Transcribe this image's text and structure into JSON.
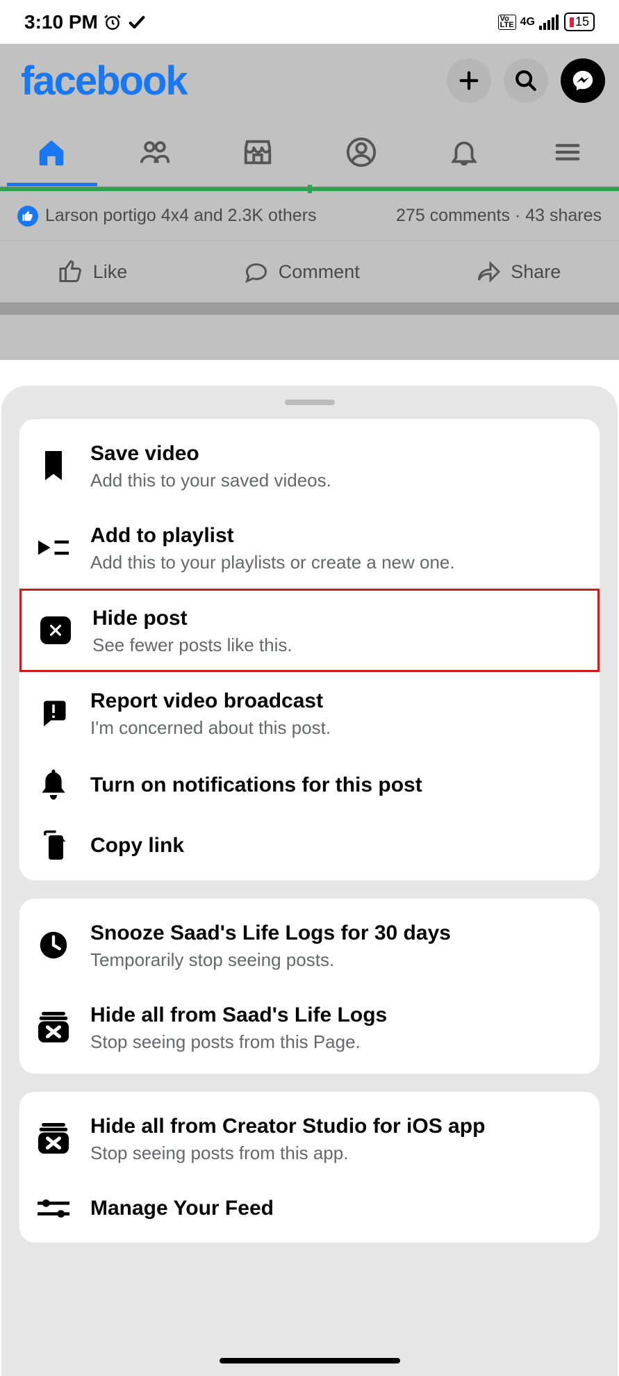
{
  "status": {
    "time": "3:10 PM",
    "network_label": "4G",
    "volte_label": "Vo\nLTE",
    "battery_pct": "15"
  },
  "fb": {
    "logo": "facebook"
  },
  "stats": {
    "likes_text": "Larson portigo 4x4 and 2.3K others",
    "comments_shares": "275 comments  ·  43 shares"
  },
  "actions": {
    "like": "Like",
    "comment": "Comment",
    "share": "Share"
  },
  "sheet": {
    "group1": [
      {
        "title": "Save video",
        "sub": "Add this to your saved videos."
      },
      {
        "title": "Add to playlist",
        "sub": "Add this to your playlists or create a new one."
      },
      {
        "title": "Hide post",
        "sub": "See fewer posts like this."
      },
      {
        "title": "Report video broadcast",
        "sub": "I'm concerned about this post."
      },
      {
        "title": "Turn on notifications for this post",
        "sub": ""
      },
      {
        "title": "Copy link",
        "sub": ""
      }
    ],
    "group2": [
      {
        "title": "Snooze Saad's Life Logs for 30 days",
        "sub": "Temporarily stop seeing posts."
      },
      {
        "title": "Hide all from Saad's Life Logs",
        "sub": "Stop seeing posts from this Page."
      }
    ],
    "group3": [
      {
        "title": "Hide all from Creator Studio for iOS app",
        "sub": "Stop seeing posts from this app."
      },
      {
        "title": "Manage Your Feed",
        "sub": ""
      }
    ]
  },
  "highlight_index": 2,
  "colors": {
    "fb_blue": "#1877f2",
    "highlight_red": "#d11a1a",
    "green": "#2fa24f"
  }
}
